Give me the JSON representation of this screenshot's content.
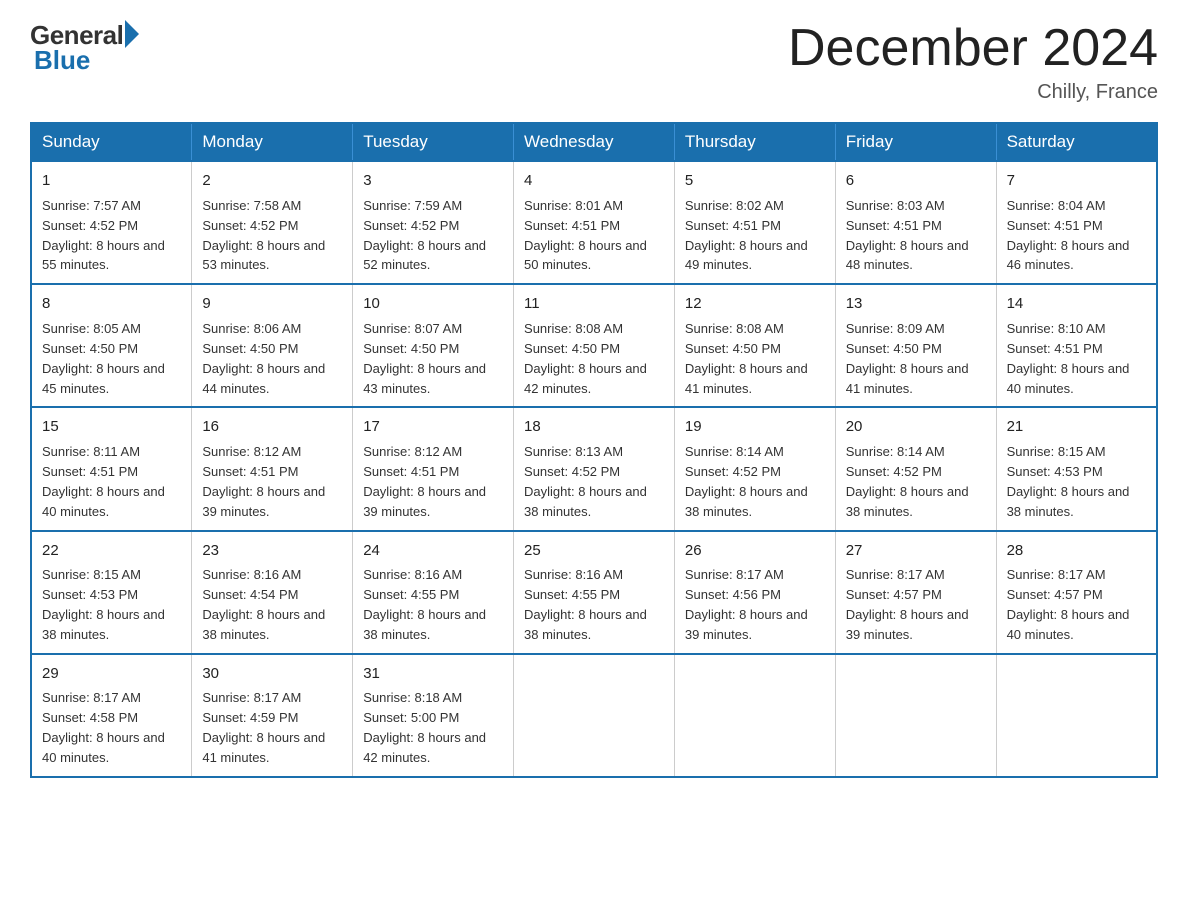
{
  "logo": {
    "general": "General",
    "blue": "Blue"
  },
  "title": {
    "month_year": "December 2024",
    "location": "Chilly, France"
  },
  "headers": [
    "Sunday",
    "Monday",
    "Tuesday",
    "Wednesday",
    "Thursday",
    "Friday",
    "Saturday"
  ],
  "weeks": [
    [
      {
        "day": "1",
        "sunrise": "7:57 AM",
        "sunset": "4:52 PM",
        "daylight": "8 hours and 55 minutes."
      },
      {
        "day": "2",
        "sunrise": "7:58 AM",
        "sunset": "4:52 PM",
        "daylight": "8 hours and 53 minutes."
      },
      {
        "day": "3",
        "sunrise": "7:59 AM",
        "sunset": "4:52 PM",
        "daylight": "8 hours and 52 minutes."
      },
      {
        "day": "4",
        "sunrise": "8:01 AM",
        "sunset": "4:51 PM",
        "daylight": "8 hours and 50 minutes."
      },
      {
        "day": "5",
        "sunrise": "8:02 AM",
        "sunset": "4:51 PM",
        "daylight": "8 hours and 49 minutes."
      },
      {
        "day": "6",
        "sunrise": "8:03 AM",
        "sunset": "4:51 PM",
        "daylight": "8 hours and 48 minutes."
      },
      {
        "day": "7",
        "sunrise": "8:04 AM",
        "sunset": "4:51 PM",
        "daylight": "8 hours and 46 minutes."
      }
    ],
    [
      {
        "day": "8",
        "sunrise": "8:05 AM",
        "sunset": "4:50 PM",
        "daylight": "8 hours and 45 minutes."
      },
      {
        "day": "9",
        "sunrise": "8:06 AM",
        "sunset": "4:50 PM",
        "daylight": "8 hours and 44 minutes."
      },
      {
        "day": "10",
        "sunrise": "8:07 AM",
        "sunset": "4:50 PM",
        "daylight": "8 hours and 43 minutes."
      },
      {
        "day": "11",
        "sunrise": "8:08 AM",
        "sunset": "4:50 PM",
        "daylight": "8 hours and 42 minutes."
      },
      {
        "day": "12",
        "sunrise": "8:08 AM",
        "sunset": "4:50 PM",
        "daylight": "8 hours and 41 minutes."
      },
      {
        "day": "13",
        "sunrise": "8:09 AM",
        "sunset": "4:50 PM",
        "daylight": "8 hours and 41 minutes."
      },
      {
        "day": "14",
        "sunrise": "8:10 AM",
        "sunset": "4:51 PM",
        "daylight": "8 hours and 40 minutes."
      }
    ],
    [
      {
        "day": "15",
        "sunrise": "8:11 AM",
        "sunset": "4:51 PM",
        "daylight": "8 hours and 40 minutes."
      },
      {
        "day": "16",
        "sunrise": "8:12 AM",
        "sunset": "4:51 PM",
        "daylight": "8 hours and 39 minutes."
      },
      {
        "day": "17",
        "sunrise": "8:12 AM",
        "sunset": "4:51 PM",
        "daylight": "8 hours and 39 minutes."
      },
      {
        "day": "18",
        "sunrise": "8:13 AM",
        "sunset": "4:52 PM",
        "daylight": "8 hours and 38 minutes."
      },
      {
        "day": "19",
        "sunrise": "8:14 AM",
        "sunset": "4:52 PM",
        "daylight": "8 hours and 38 minutes."
      },
      {
        "day": "20",
        "sunrise": "8:14 AM",
        "sunset": "4:52 PM",
        "daylight": "8 hours and 38 minutes."
      },
      {
        "day": "21",
        "sunrise": "8:15 AM",
        "sunset": "4:53 PM",
        "daylight": "8 hours and 38 minutes."
      }
    ],
    [
      {
        "day": "22",
        "sunrise": "8:15 AM",
        "sunset": "4:53 PM",
        "daylight": "8 hours and 38 minutes."
      },
      {
        "day": "23",
        "sunrise": "8:16 AM",
        "sunset": "4:54 PM",
        "daylight": "8 hours and 38 minutes."
      },
      {
        "day": "24",
        "sunrise": "8:16 AM",
        "sunset": "4:55 PM",
        "daylight": "8 hours and 38 minutes."
      },
      {
        "day": "25",
        "sunrise": "8:16 AM",
        "sunset": "4:55 PM",
        "daylight": "8 hours and 38 minutes."
      },
      {
        "day": "26",
        "sunrise": "8:17 AM",
        "sunset": "4:56 PM",
        "daylight": "8 hours and 39 minutes."
      },
      {
        "day": "27",
        "sunrise": "8:17 AM",
        "sunset": "4:57 PM",
        "daylight": "8 hours and 39 minutes."
      },
      {
        "day": "28",
        "sunrise": "8:17 AM",
        "sunset": "4:57 PM",
        "daylight": "8 hours and 40 minutes."
      }
    ],
    [
      {
        "day": "29",
        "sunrise": "8:17 AM",
        "sunset": "4:58 PM",
        "daylight": "8 hours and 40 minutes."
      },
      {
        "day": "30",
        "sunrise": "8:17 AM",
        "sunset": "4:59 PM",
        "daylight": "8 hours and 41 minutes."
      },
      {
        "day": "31",
        "sunrise": "8:18 AM",
        "sunset": "5:00 PM",
        "daylight": "8 hours and 42 minutes."
      },
      {
        "day": "",
        "sunrise": "",
        "sunset": "",
        "daylight": ""
      },
      {
        "day": "",
        "sunrise": "",
        "sunset": "",
        "daylight": ""
      },
      {
        "day": "",
        "sunrise": "",
        "sunset": "",
        "daylight": ""
      },
      {
        "day": "",
        "sunrise": "",
        "sunset": "",
        "daylight": ""
      }
    ]
  ]
}
